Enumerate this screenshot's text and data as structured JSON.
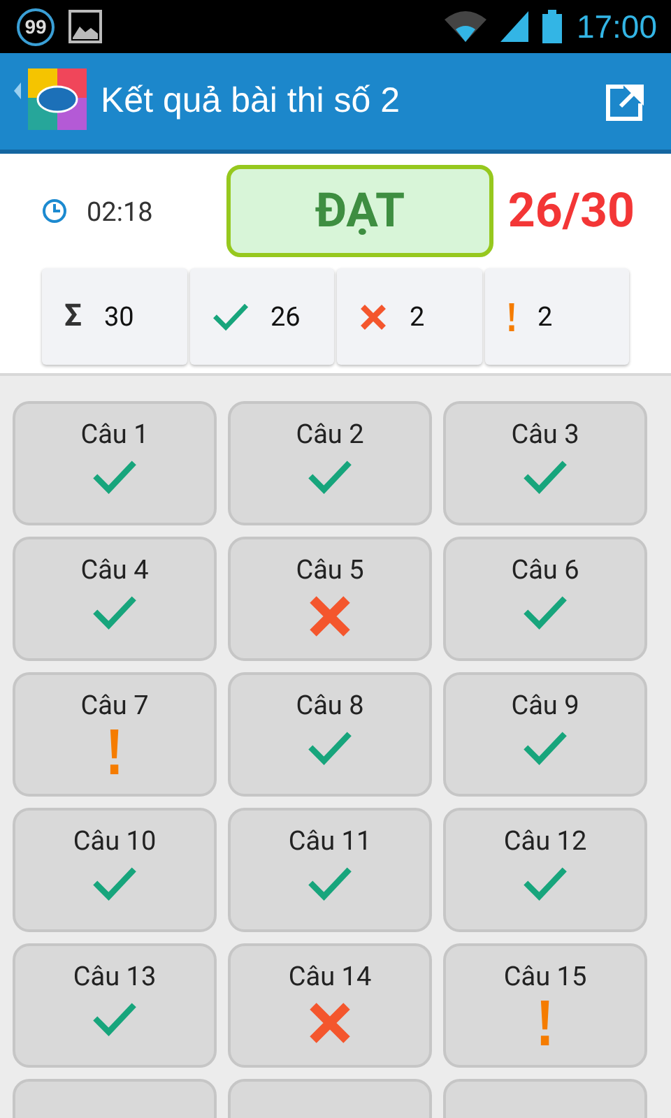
{
  "status_bar": {
    "notification_count": "99",
    "time": "17:00"
  },
  "app_bar": {
    "title": "Kết quả bài thi số 2"
  },
  "summary": {
    "time": "02:18",
    "result": "ĐẠT",
    "passed": true,
    "score": "26/30"
  },
  "stats": [
    {
      "kind": "total",
      "symbol": "Σ",
      "value": "30"
    },
    {
      "kind": "correct",
      "value": "26"
    },
    {
      "kind": "wrong",
      "value": "2"
    },
    {
      "kind": "unanswered",
      "value": "2"
    }
  ],
  "questions": [
    {
      "label": "Câu 1",
      "kind": "correct"
    },
    {
      "label": "Câu 2",
      "kind": "correct"
    },
    {
      "label": "Câu 3",
      "kind": "correct"
    },
    {
      "label": "Câu 4",
      "kind": "correct"
    },
    {
      "label": "Câu 5",
      "kind": "wrong"
    },
    {
      "label": "Câu 6",
      "kind": "correct"
    },
    {
      "label": "Câu 7",
      "kind": "unanswered"
    },
    {
      "label": "Câu 8",
      "kind": "correct"
    },
    {
      "label": "Câu 9",
      "kind": "correct"
    },
    {
      "label": "Câu 10",
      "kind": "correct"
    },
    {
      "label": "Câu 11",
      "kind": "correct"
    },
    {
      "label": "Câu 12",
      "kind": "correct"
    },
    {
      "label": "Câu 13",
      "kind": "correct"
    },
    {
      "label": "Câu 14",
      "kind": "wrong"
    },
    {
      "label": "Câu 15",
      "kind": "unanswered"
    },
    {
      "kind": "hidden"
    },
    {
      "kind": "hidden"
    },
    {
      "kind": "hidden"
    }
  ]
}
